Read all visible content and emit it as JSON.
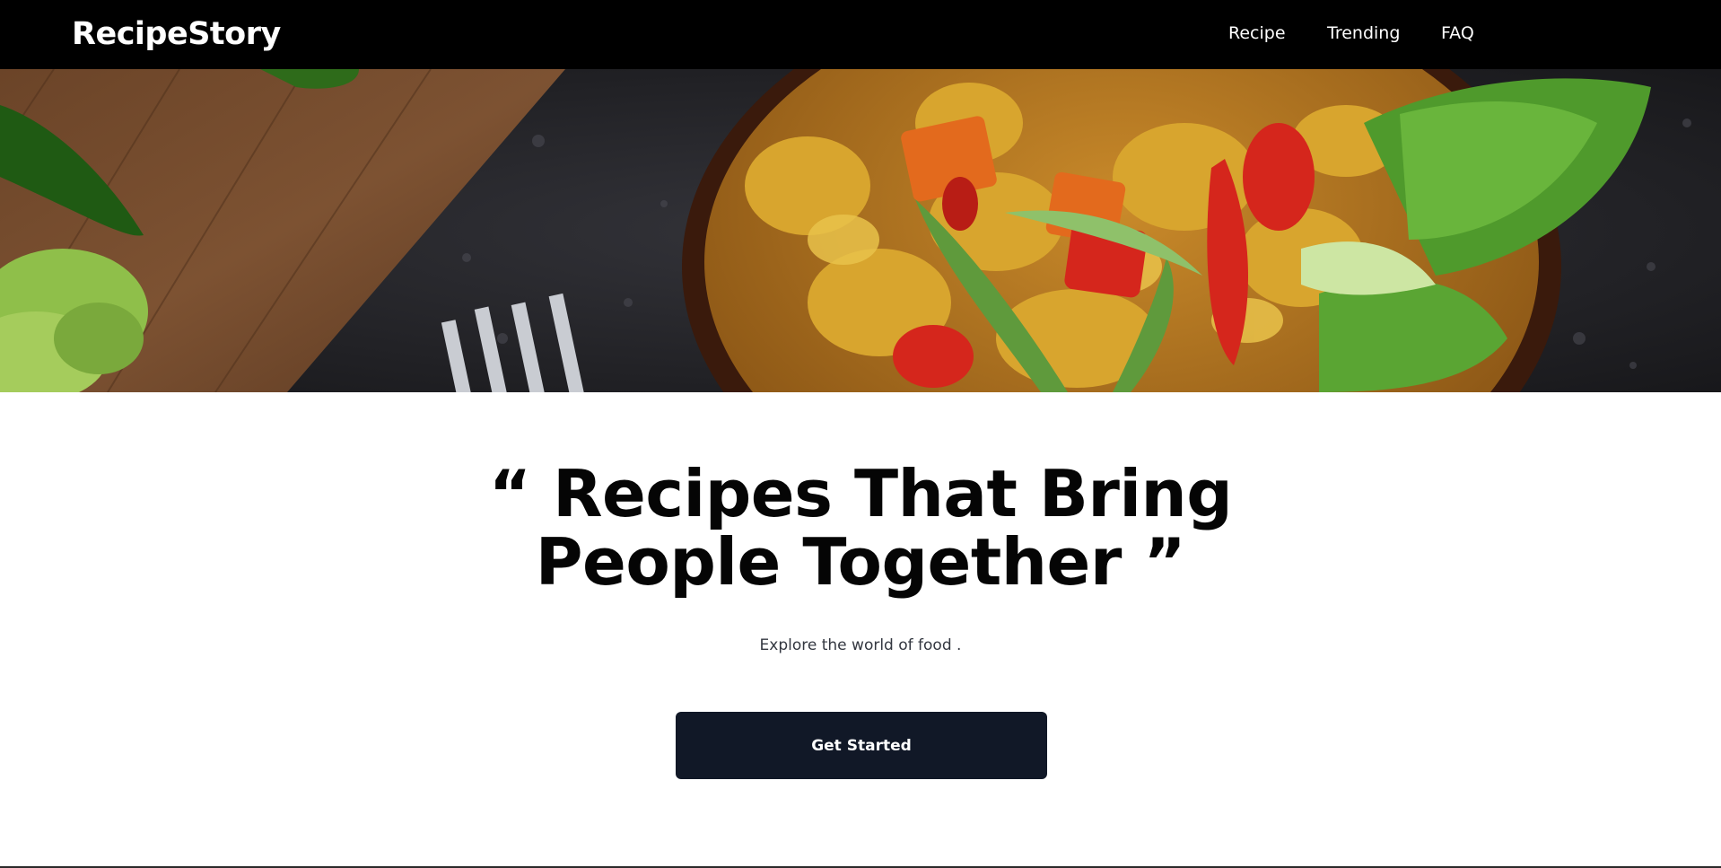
{
  "navbar": {
    "brand": "RecipeStory",
    "links": [
      {
        "label": "Recipe"
      },
      {
        "label": "Trending"
      },
      {
        "label": "FAQ"
      }
    ]
  },
  "hero": {
    "image_alt": "Bowl of curry chicken stir-fry with vegetables",
    "headline_line1": "“ Recipes That Bring",
    "headline_line2": "People Together ”",
    "tagline": "Explore the world of food .",
    "cta_label": "Get Started"
  },
  "colors": {
    "navbar_bg": "#000000",
    "button_bg": "#111827",
    "headline": "#050505"
  }
}
